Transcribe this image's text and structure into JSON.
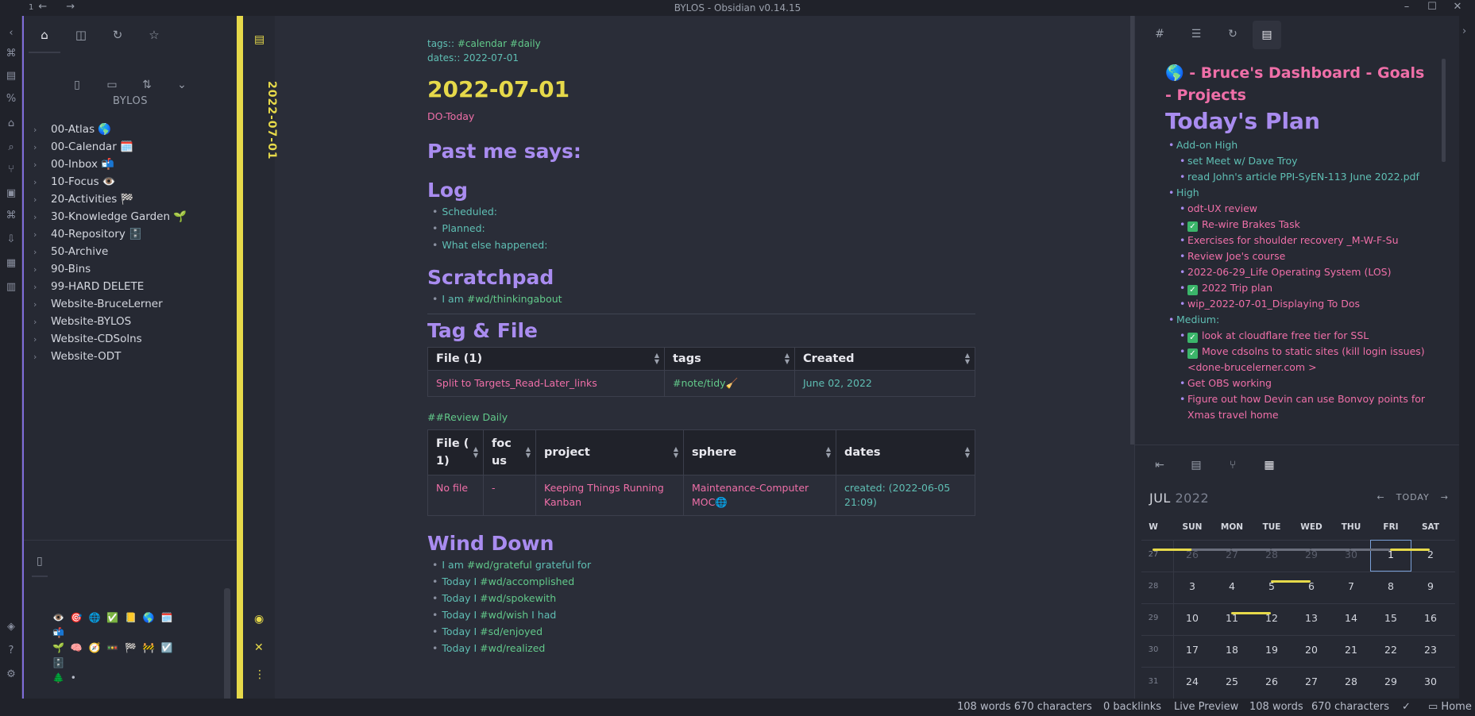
{
  "window": {
    "title": "BYLOS - Obsidian v0.14.15",
    "tab_count": "1"
  },
  "ribbon": {
    "icons": [
      "collapse-left-icon",
      "graph-icon",
      "outline-icon",
      "code-icon",
      "home-icon",
      "search-icon",
      "branch-icon",
      "gallery-icon",
      "command-icon",
      "import-icon",
      "layout-icon",
      "calendar-icon",
      "vault-icon",
      "help-icon",
      "settings-icon"
    ]
  },
  "left_panel": {
    "tabs": [
      "home-icon",
      "file-search-icon",
      "recent-icon",
      "star-icon"
    ],
    "tools": [
      "new-note-icon",
      "new-folder-icon",
      "sort-icon",
      "collapse-all-icon"
    ],
    "vault_name": "BYLOS",
    "folders": [
      {
        "label": "00-Atlas 🌎"
      },
      {
        "label": "00-Calendar 🗓️"
      },
      {
        "label": "00-Inbox 📬"
      },
      {
        "label": "10-Focus 👁️"
      },
      {
        "label": "20-Activities 🏁"
      },
      {
        "label": "30-Knowledge Garden 🌱"
      },
      {
        "label": "40-Repository 🗄️"
      },
      {
        "label": "50-Archive"
      },
      {
        "label": "90-Bins"
      },
      {
        "label": "99-HARD DELETE"
      },
      {
        "label": "Website-BruceLerner"
      },
      {
        "label": "Website-BYLOS"
      },
      {
        "label": "Website-CDSolns"
      },
      {
        "label": "Website-ODT"
      }
    ],
    "emoji_line1": "👁️ 🎯 🌐 ✅ 📒 🌎 🗓️ 📬",
    "emoji_line2": "🌱 🧠 🧭 🚥 🏁 🚧 ☑️ 🗄️",
    "emoji_line3": "🌲 •"
  },
  "editor": {
    "tab_title": "2022-07-01",
    "meta": {
      "tags_label": "tags::",
      "tags": "#calendar #daily",
      "dates_label": "dates::",
      "dates": "2022-07-01"
    },
    "h1": "2022-07-01",
    "do_today": "DO-Today",
    "past_me": "Past me says:",
    "log": {
      "heading": "Log",
      "items": [
        "Scheduled:",
        "Planned:",
        "What else happened:"
      ]
    },
    "scratchpad": {
      "heading": "Scratchpad",
      "item_prefix": "I am",
      "item_tag": "#wd/thinkingabout"
    },
    "tagfile": {
      "heading": "Tag & File",
      "headers": [
        "File (1)",
        "tags",
        "Created"
      ],
      "rows": [
        [
          "Split to Targets_Read-Later_links",
          "#note/tidy🧹",
          "June 02, 2022"
        ]
      ]
    },
    "review_label": "##Review Daily",
    "review": {
      "headers": [
        "File ( 1)",
        "foc us",
        "project",
        "sphere",
        "dates"
      ],
      "rows": [
        [
          "No file",
          "-",
          "Keeping Things Running Kanban",
          "Maintenance-Computer MOC🌐",
          "created: (2022-06-05 21:09)"
        ]
      ]
    },
    "wind": {
      "heading": "Wind Down",
      "items": [
        {
          "prefix": "I am",
          "tag": "#wd/grateful",
          "suffix": "grateful for"
        },
        {
          "prefix": "Today I",
          "tag": "#wd/accomplished",
          "suffix": ""
        },
        {
          "prefix": "Today I",
          "tag": "#wd/spokewith",
          "suffix": ""
        },
        {
          "prefix": "Today I",
          "tag": "#wd/wish",
          "suffix": "I had"
        },
        {
          "prefix": "Today I",
          "tag": "#sd/enjoyed",
          "suffix": ""
        },
        {
          "prefix": "Today I",
          "tag": "#wd/realized",
          "suffix": ""
        }
      ]
    }
  },
  "right_panel": {
    "tabs": [
      "tag-icon",
      "list-icon",
      "recent-icon",
      "doc-icon"
    ],
    "dashboard_title": "🌎  - Bruce's Dashboard - Goals - Projects",
    "plan_heading": "Today's Plan",
    "plan": {
      "addon": "Add-on High",
      "addon_items": [
        "set Meet w/ Dave Troy",
        "read John's article PPI-SyEN-113 June 2022.pdf"
      ],
      "high": "High",
      "high_items": [
        {
          "text": "odt-UX review",
          "done": false
        },
        {
          "text": "Re-wire Brakes Task",
          "done": true
        },
        {
          "text": "Exercises for shoulder recovery _M-W-F-Su",
          "done": false
        },
        {
          "text": "Review Joe's course",
          "done": false
        },
        {
          "text": "2022-06-29_Life Operating System (LOS)",
          "done": false
        },
        {
          "text": "2022 Trip plan",
          "done": true
        },
        {
          "text": "wip_2022-07-01_Displaying To Dos",
          "done": false
        }
      ],
      "medium": "Medium:",
      "medium_items": [
        {
          "text": "look at cloudflare free tier for SSL",
          "done": true
        },
        {
          "text": "Move cdsolns to static sites (kill login issues)<done-brucelerner.com >",
          "done": true
        },
        {
          "text": "Get OBS working",
          "done": false
        },
        {
          "text": "Figure out how Devin can use Bonvoy points for Xmas travel home",
          "done": false
        }
      ]
    },
    "bottom_tabs": [
      "outline-icon",
      "doc-icon",
      "graph-icon",
      "calendar-icon"
    ],
    "calendar": {
      "month": "JUL",
      "year": "2022",
      "today_label": "TODAY",
      "dow": [
        "W",
        "SUN",
        "MON",
        "TUE",
        "WED",
        "THU",
        "FRI",
        "SAT"
      ],
      "weeks": [
        {
          "wn": "27",
          "days": [
            "26",
            "27",
            "28",
            "29",
            "30",
            "1",
            "2"
          ]
        },
        {
          "wn": "28",
          "days": [
            "3",
            "4",
            "5",
            "6",
            "7",
            "8",
            "9"
          ]
        },
        {
          "wn": "29",
          "days": [
            "10",
            "11",
            "12",
            "13",
            "14",
            "15",
            "16"
          ]
        },
        {
          "wn": "30",
          "days": [
            "17",
            "18",
            "19",
            "20",
            "21",
            "22",
            "23"
          ]
        },
        {
          "wn": "31",
          "days": [
            "24",
            "25",
            "26",
            "27",
            "28",
            "29",
            "30"
          ]
        }
      ]
    }
  },
  "status": {
    "words": "108 words 670 characters",
    "backlinks": "0 backlinks",
    "mode": "Live Preview",
    "words2": "108 words",
    "chars2": "670 characters",
    "home": "Home"
  }
}
